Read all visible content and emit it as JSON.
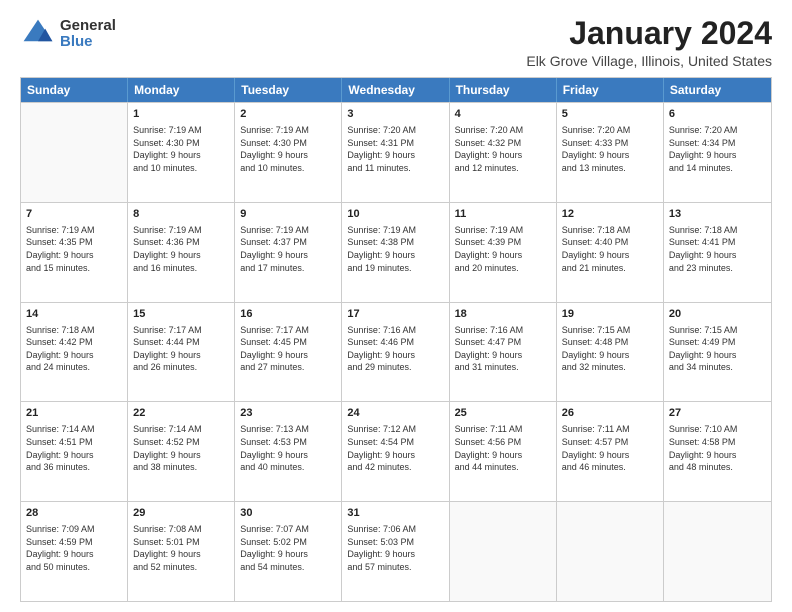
{
  "logo": {
    "general": "General",
    "blue": "Blue"
  },
  "title": "January 2024",
  "subtitle": "Elk Grove Village, Illinois, United States",
  "days": [
    "Sunday",
    "Monday",
    "Tuesday",
    "Wednesday",
    "Thursday",
    "Friday",
    "Saturday"
  ],
  "weeks": [
    [
      {
        "day": "",
        "content": ""
      },
      {
        "day": "1",
        "content": "Sunrise: 7:19 AM\nSunset: 4:30 PM\nDaylight: 9 hours\nand 10 minutes."
      },
      {
        "day": "2",
        "content": "Sunrise: 7:19 AM\nSunset: 4:30 PM\nDaylight: 9 hours\nand 10 minutes."
      },
      {
        "day": "3",
        "content": "Sunrise: 7:20 AM\nSunset: 4:31 PM\nDaylight: 9 hours\nand 11 minutes."
      },
      {
        "day": "4",
        "content": "Sunrise: 7:20 AM\nSunset: 4:32 PM\nDaylight: 9 hours\nand 12 minutes."
      },
      {
        "day": "5",
        "content": "Sunrise: 7:20 AM\nSunset: 4:33 PM\nDaylight: 9 hours\nand 13 minutes."
      },
      {
        "day": "6",
        "content": "Sunrise: 7:20 AM\nSunset: 4:34 PM\nDaylight: 9 hours\nand 14 minutes."
      }
    ],
    [
      {
        "day": "7",
        "content": "Sunrise: 7:19 AM\nSunset: 4:35 PM\nDaylight: 9 hours\nand 15 minutes."
      },
      {
        "day": "8",
        "content": "Sunrise: 7:19 AM\nSunset: 4:36 PM\nDaylight: 9 hours\nand 16 minutes."
      },
      {
        "day": "9",
        "content": "Sunrise: 7:19 AM\nSunset: 4:37 PM\nDaylight: 9 hours\nand 17 minutes."
      },
      {
        "day": "10",
        "content": "Sunrise: 7:19 AM\nSunset: 4:38 PM\nDaylight: 9 hours\nand 19 minutes."
      },
      {
        "day": "11",
        "content": "Sunrise: 7:19 AM\nSunset: 4:39 PM\nDaylight: 9 hours\nand 20 minutes."
      },
      {
        "day": "12",
        "content": "Sunrise: 7:18 AM\nSunset: 4:40 PM\nDaylight: 9 hours\nand 21 minutes."
      },
      {
        "day": "13",
        "content": "Sunrise: 7:18 AM\nSunset: 4:41 PM\nDaylight: 9 hours\nand 23 minutes."
      }
    ],
    [
      {
        "day": "14",
        "content": "Sunrise: 7:18 AM\nSunset: 4:42 PM\nDaylight: 9 hours\nand 24 minutes."
      },
      {
        "day": "15",
        "content": "Sunrise: 7:17 AM\nSunset: 4:44 PM\nDaylight: 9 hours\nand 26 minutes."
      },
      {
        "day": "16",
        "content": "Sunrise: 7:17 AM\nSunset: 4:45 PM\nDaylight: 9 hours\nand 27 minutes."
      },
      {
        "day": "17",
        "content": "Sunrise: 7:16 AM\nSunset: 4:46 PM\nDaylight: 9 hours\nand 29 minutes."
      },
      {
        "day": "18",
        "content": "Sunrise: 7:16 AM\nSunset: 4:47 PM\nDaylight: 9 hours\nand 31 minutes."
      },
      {
        "day": "19",
        "content": "Sunrise: 7:15 AM\nSunset: 4:48 PM\nDaylight: 9 hours\nand 32 minutes."
      },
      {
        "day": "20",
        "content": "Sunrise: 7:15 AM\nSunset: 4:49 PM\nDaylight: 9 hours\nand 34 minutes."
      }
    ],
    [
      {
        "day": "21",
        "content": "Sunrise: 7:14 AM\nSunset: 4:51 PM\nDaylight: 9 hours\nand 36 minutes."
      },
      {
        "day": "22",
        "content": "Sunrise: 7:14 AM\nSunset: 4:52 PM\nDaylight: 9 hours\nand 38 minutes."
      },
      {
        "day": "23",
        "content": "Sunrise: 7:13 AM\nSunset: 4:53 PM\nDaylight: 9 hours\nand 40 minutes."
      },
      {
        "day": "24",
        "content": "Sunrise: 7:12 AM\nSunset: 4:54 PM\nDaylight: 9 hours\nand 42 minutes."
      },
      {
        "day": "25",
        "content": "Sunrise: 7:11 AM\nSunset: 4:56 PM\nDaylight: 9 hours\nand 44 minutes."
      },
      {
        "day": "26",
        "content": "Sunrise: 7:11 AM\nSunset: 4:57 PM\nDaylight: 9 hours\nand 46 minutes."
      },
      {
        "day": "27",
        "content": "Sunrise: 7:10 AM\nSunset: 4:58 PM\nDaylight: 9 hours\nand 48 minutes."
      }
    ],
    [
      {
        "day": "28",
        "content": "Sunrise: 7:09 AM\nSunset: 4:59 PM\nDaylight: 9 hours\nand 50 minutes."
      },
      {
        "day": "29",
        "content": "Sunrise: 7:08 AM\nSunset: 5:01 PM\nDaylight: 9 hours\nand 52 minutes."
      },
      {
        "day": "30",
        "content": "Sunrise: 7:07 AM\nSunset: 5:02 PM\nDaylight: 9 hours\nand 54 minutes."
      },
      {
        "day": "31",
        "content": "Sunrise: 7:06 AM\nSunset: 5:03 PM\nDaylight: 9 hours\nand 57 minutes."
      },
      {
        "day": "",
        "content": ""
      },
      {
        "day": "",
        "content": ""
      },
      {
        "day": "",
        "content": ""
      }
    ]
  ]
}
